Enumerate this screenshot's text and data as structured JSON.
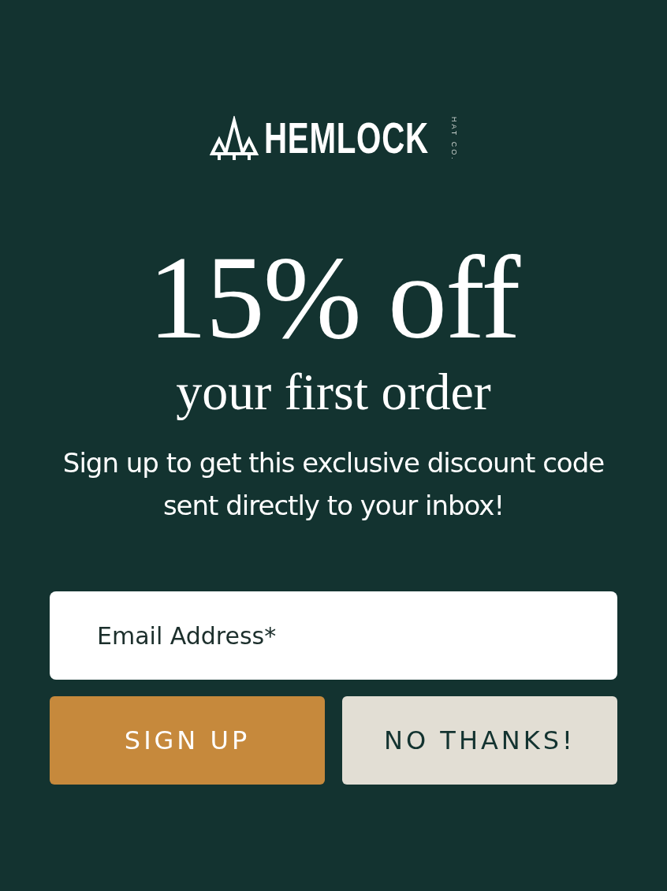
{
  "logo": {
    "wordmark": "HEMLOCK",
    "tagline": "HAT CO."
  },
  "headline": "15% off",
  "subheadline": "your first order",
  "description": "Sign up to get this exclusive discount code sent directly to your inbox!",
  "email_field": {
    "placeholder": "Email Address*"
  },
  "buttons": [
    {
      "label": "SIGN UP",
      "kind": "primary"
    },
    {
      "label": "NO THANKS!",
      "kind": "secondary"
    }
  ]
}
